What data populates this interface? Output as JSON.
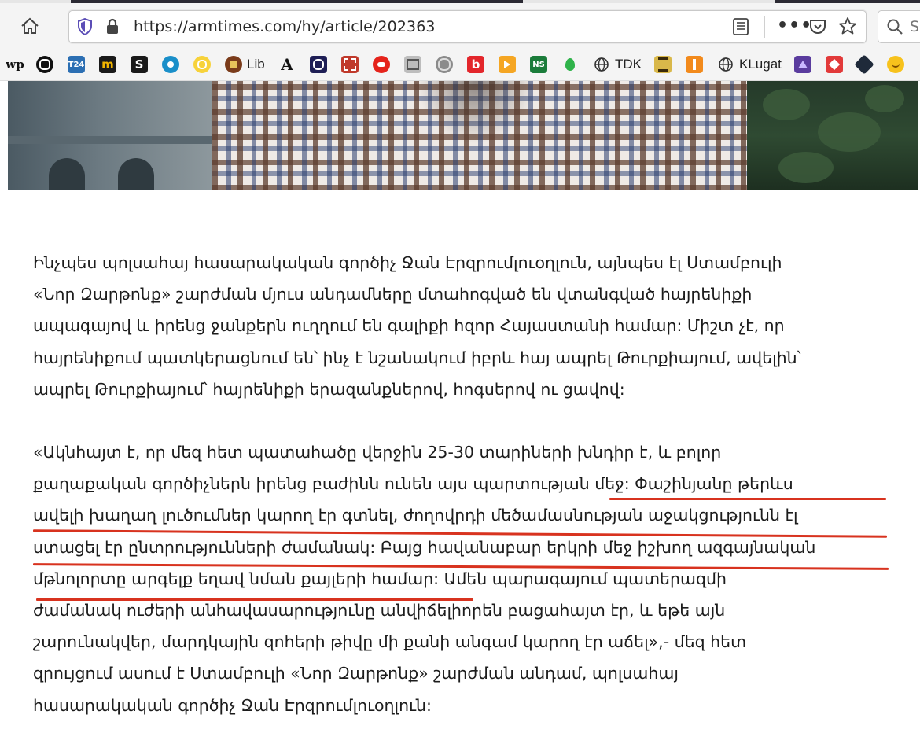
{
  "browser": {
    "url": "https://armtimes.com/hy/article/202363",
    "search_partial": "S",
    "icons": {
      "home": "home-icon",
      "tracking": "shield-icon",
      "lock": "lock-icon",
      "reader": "reader-view-icon",
      "more": "ellipsis-icon",
      "pocket": "pocket-icon",
      "bookmark": "star-icon",
      "search": "search-icon"
    },
    "page_actions_glyph": "•••"
  },
  "bookmarks": [
    {
      "label": "",
      "icon": "wp"
    },
    {
      "label": "",
      "icon": "O"
    },
    {
      "label": "",
      "icon": "T24"
    },
    {
      "label": "",
      "icon": "m"
    },
    {
      "label": "",
      "icon": "S"
    },
    {
      "label": "",
      "icon": "bird"
    },
    {
      "label": "",
      "icon": "swirl"
    },
    {
      "label": "Lib",
      "icon": "crest"
    },
    {
      "label": "",
      "icon": "A"
    },
    {
      "label": "",
      "icon": "circle"
    },
    {
      "label": "",
      "icon": "ornament"
    },
    {
      "label": "",
      "icon": "eagle"
    },
    {
      "label": "",
      "icon": "box"
    },
    {
      "label": "",
      "icon": "globe-grey"
    },
    {
      "label": "",
      "icon": "b"
    },
    {
      "label": "",
      "icon": "tv"
    },
    {
      "label": "",
      "icon": "NS"
    },
    {
      "label": "",
      "icon": "drop"
    },
    {
      "label": "TDK",
      "icon": "globe"
    },
    {
      "label": "",
      "icon": "calligraphy"
    },
    {
      "label": "",
      "icon": "figure"
    },
    {
      "label": "KLugat",
      "icon": "globe"
    },
    {
      "label": "",
      "icon": "purple"
    },
    {
      "label": "",
      "icon": "red-heart"
    },
    {
      "label": "",
      "icon": "dark"
    },
    {
      "label": "",
      "icon": "smile"
    }
  ],
  "article": {
    "paragraph1": [
      "Ինչպես պոլսահայ հասարակական գործիչ Ջան Էրզրումլուօղլուն, այնպես էլ Ստամբուլի",
      "«Նոր Զարթոնք» շարժման մյուս անդամները մտահոգված են վտանգված հայրենիքի",
      "ապագայով և իրենց ջանքերն ուղղում են գալիքի հզոր Հայաստանի համար: Միշտ չէ, որ",
      "հայրենիքում պատկերացնում են՝ ինչ է նշանակում իբրև հայ ապրել Թուրքիայում, ավելին՝",
      "ապրել Թուրքիայում՝ հայրենիքի երազանքներով, հոգսերով ու ցավով:"
    ],
    "paragraph2": [
      "«Ակնհայտ է, որ մեզ հետ պատահածը վերջին 25-30 տարիների խնդիր է, և բոլոր",
      "քաղաքական գործիչներն իրենց բաժինն ունեն այս պարտության մեջ: Փաշինյանը թերևս",
      "ավելի խաղաղ լուծումներ կարող էր գտնել, ժողովրդի մեծամասնության աջակցությունն էլ",
      "ստացել էր ընտրությունների ժամանակ: Բայց հավանաբար երկրի մեջ իշխող ազգայնական",
      "մթնոլորտը արգելք եղավ նման քայլերի համար: Ամեն պարագայում պատերազմի",
      "ժամանակ ուժերի անհավասարությունը անվիճելիորեն բացահայտ էր, և եթե այն",
      "շարունակվեր, մարդկային զոհերի թիվը մի քանի անգամ կարող էր աճել»,- մեզ հետ",
      "զրույցում ասում է Ստամբուլի «Նոր Զարթոնք» շարժման անդամ, պոլսահայ",
      "հասարակական գործիչ Ջան Էրզրումլուօղլուն:"
    ]
  },
  "annotation_color": "#d8331f"
}
